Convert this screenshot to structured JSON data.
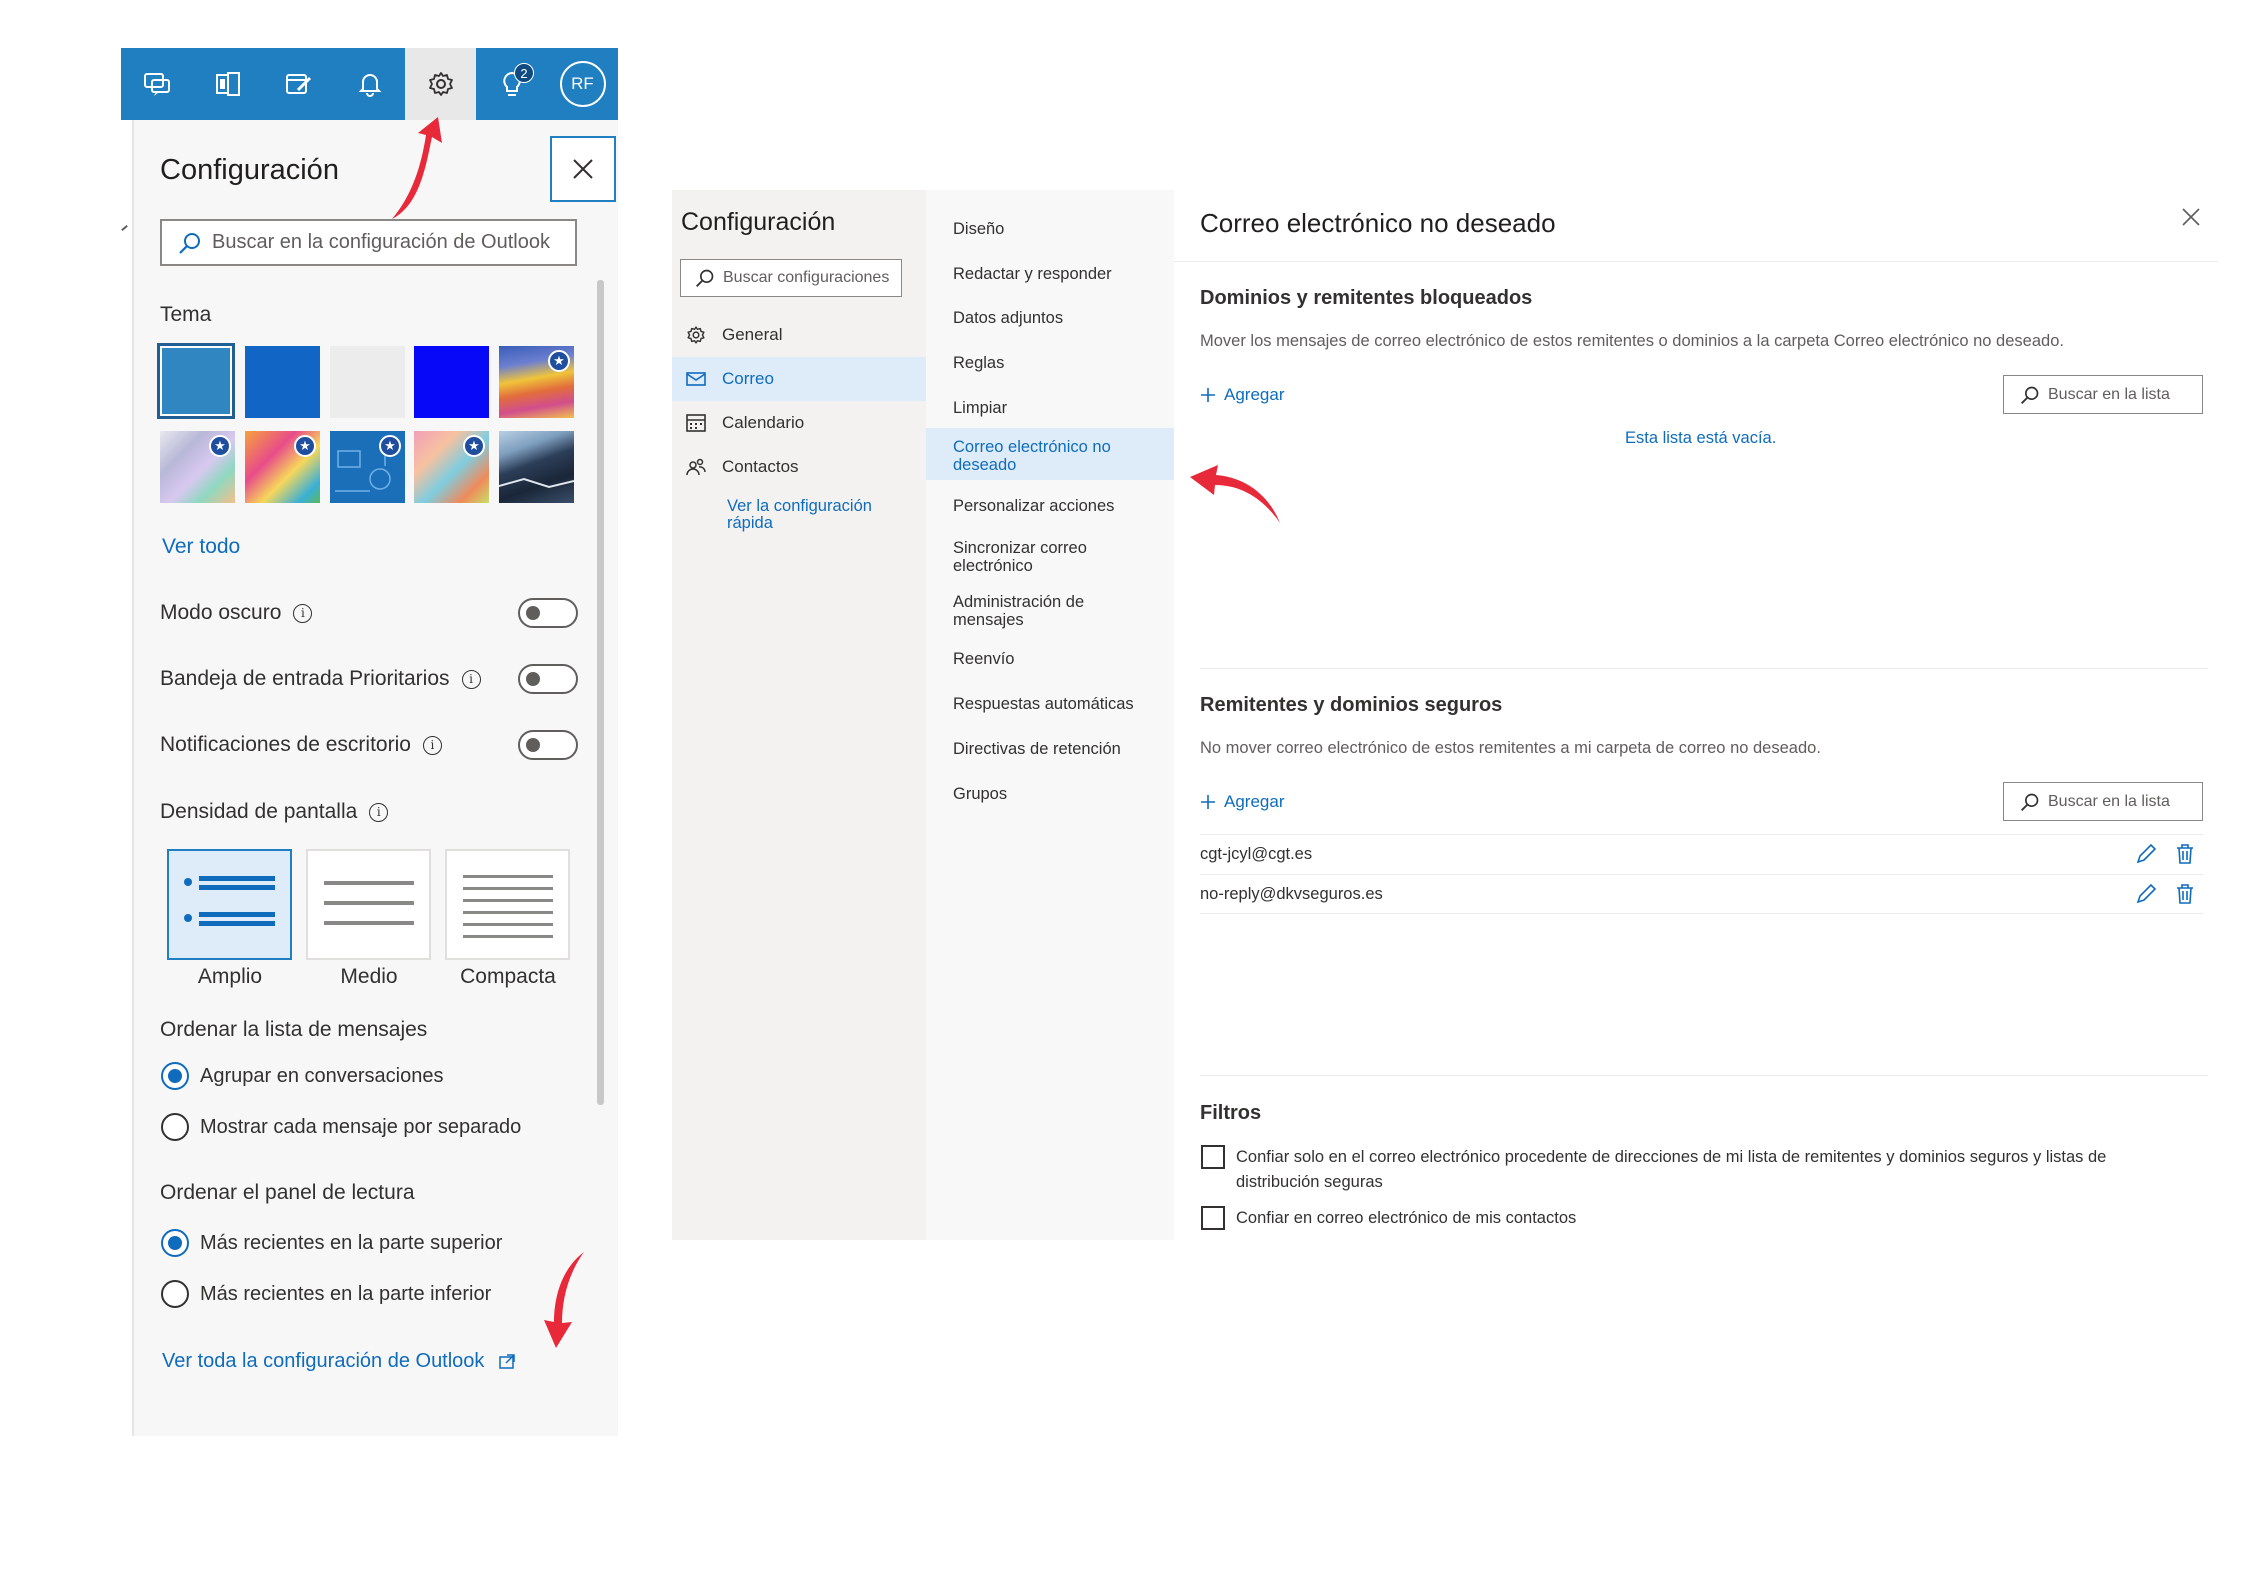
{
  "quick_panel": {
    "toolbar": {
      "badge_count": "2",
      "avatar_initials": "RF",
      "icons": [
        "teams-chat-icon",
        "office-apps-icon",
        "my-day-icon",
        "bell-icon",
        "gear-icon",
        "lightbulb-icon"
      ]
    },
    "title": "Configuración",
    "search_placeholder": "Buscar en la configuración de Outlook",
    "theme": {
      "heading": "Tema",
      "see_all": "Ver todo"
    },
    "toggles": {
      "dark_mode": "Modo oscuro",
      "focused_inbox": "Bandeja de entrada Prioritarios",
      "desktop_notifications": "Notificaciones de escritorio"
    },
    "density": {
      "heading": "Densidad de pantalla",
      "options": [
        "Amplio",
        "Medio",
        "Compacta"
      ],
      "selected": "Amplio"
    },
    "sort_messages": {
      "heading": "Ordenar la lista de mensajes",
      "options": [
        "Agrupar en conversaciones",
        "Mostrar cada mensaje por separado"
      ],
      "selected": "Agrupar en conversaciones"
    },
    "reading_pane": {
      "heading": "Ordenar el panel de lectura",
      "options": [
        "Más recientes en la parte superior",
        "Más recientes en la parte inferior"
      ],
      "selected": "Más recientes en la parte superior"
    },
    "view_all_link": "Ver toda la configuración de Outlook"
  },
  "settings_window": {
    "title": "Configuración",
    "search_placeholder": "Buscar configuraciones",
    "categories": [
      "General",
      "Correo",
      "Calendario",
      "Contactos"
    ],
    "selected_category": "Correo",
    "quick_settings_link": "Ver la configuración rápida",
    "subcategories": [
      "Diseño",
      "Redactar y responder",
      "Datos adjuntos",
      "Reglas",
      "Limpiar",
      "Correo electrónico no deseado",
      "Personalizar acciones",
      "Sincronizar correo electrónico",
      "Administración de mensajes",
      "Reenvío",
      "Respuestas automáticas",
      "Directivas de retención",
      "Grupos"
    ],
    "selected_subcategory": "Correo electrónico no deseado"
  },
  "junk_email": {
    "title": "Correo electrónico no deseado",
    "blocked": {
      "heading": "Dominios y remitentes bloqueados",
      "description": "Mover los mensajes de correo electrónico de estos remitentes o dominios a la carpeta Correo electrónico no deseado.",
      "add_label": "Agregar",
      "search_placeholder": "Buscar en la lista",
      "empty_text": "Esta lista está vacía."
    },
    "safe": {
      "heading": "Remitentes y dominios seguros",
      "description": "No mover correo electrónico de estos remitentes a mi carpeta de correo no deseado.",
      "add_label": "Agregar",
      "search_placeholder": "Buscar en la lista",
      "entries": [
        "cgt-jcyl@cgt.es",
        "no-reply@dkvseguros.es"
      ]
    },
    "filters": {
      "heading": "Filtros",
      "options": [
        "Confiar solo en el correo electrónico procedente de direcciones de mi lista de remitentes y dominios seguros y listas de distribución seguras",
        "Confiar en correo electrónico de mis contactos"
      ]
    }
  },
  "colors": {
    "outlook_blue": "#1f7fc1",
    "link_blue": "#0f6cbd",
    "selected_bg": "#deecf9",
    "arrow_red": "#e8293a"
  }
}
